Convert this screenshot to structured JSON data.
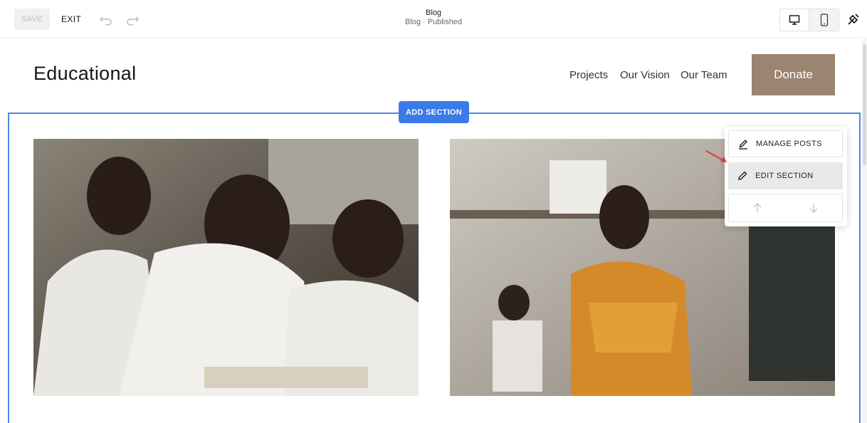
{
  "toolbar": {
    "save_label": "SAVE",
    "exit_label": "EXIT",
    "page_title": "Blog",
    "page_status": "Blog · Published"
  },
  "site": {
    "logo": "Educational",
    "nav": [
      "Projects",
      "Our Vision",
      "Our Team"
    ],
    "donate_label": "Donate"
  },
  "editor": {
    "add_section_label": "ADD SECTION",
    "menu": {
      "manage_posts_label": "MANAGE POSTS",
      "edit_section_label": "EDIT SECTION"
    }
  },
  "colors": {
    "accent": "#3a7be8",
    "donate": "#9b8470"
  }
}
